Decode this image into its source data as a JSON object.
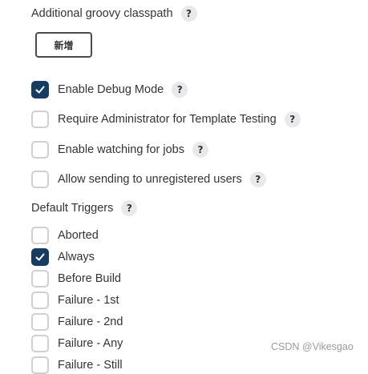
{
  "classpath": {
    "label": "Additional groovy classpath",
    "help": "?",
    "add_button": "新增"
  },
  "options": [
    {
      "label": "Enable Debug Mode",
      "checked": true,
      "help": "?"
    },
    {
      "label": "Require Administrator for Template Testing",
      "checked": false,
      "help": "?"
    },
    {
      "label": "Enable watching for jobs",
      "checked": false,
      "help": "?"
    },
    {
      "label": "Allow sending to unregistered users",
      "checked": false,
      "help": "?"
    }
  ],
  "triggers": {
    "label": "Default Triggers",
    "help": "?",
    "items": [
      {
        "label": "Aborted",
        "checked": false
      },
      {
        "label": "Always",
        "checked": true
      },
      {
        "label": "Before Build",
        "checked": false
      },
      {
        "label": "Failure - 1st",
        "checked": false
      },
      {
        "label": "Failure - 2nd",
        "checked": false
      },
      {
        "label": "Failure - Any",
        "checked": false
      },
      {
        "label": "Failure - Still",
        "checked": false
      }
    ]
  },
  "watermark": "CSDN @Vikesgao",
  "colors": {
    "checkbox_checked": "#163c61",
    "checkbox_border": "#cfcfd6",
    "help_bg": "#e9e9ec"
  }
}
